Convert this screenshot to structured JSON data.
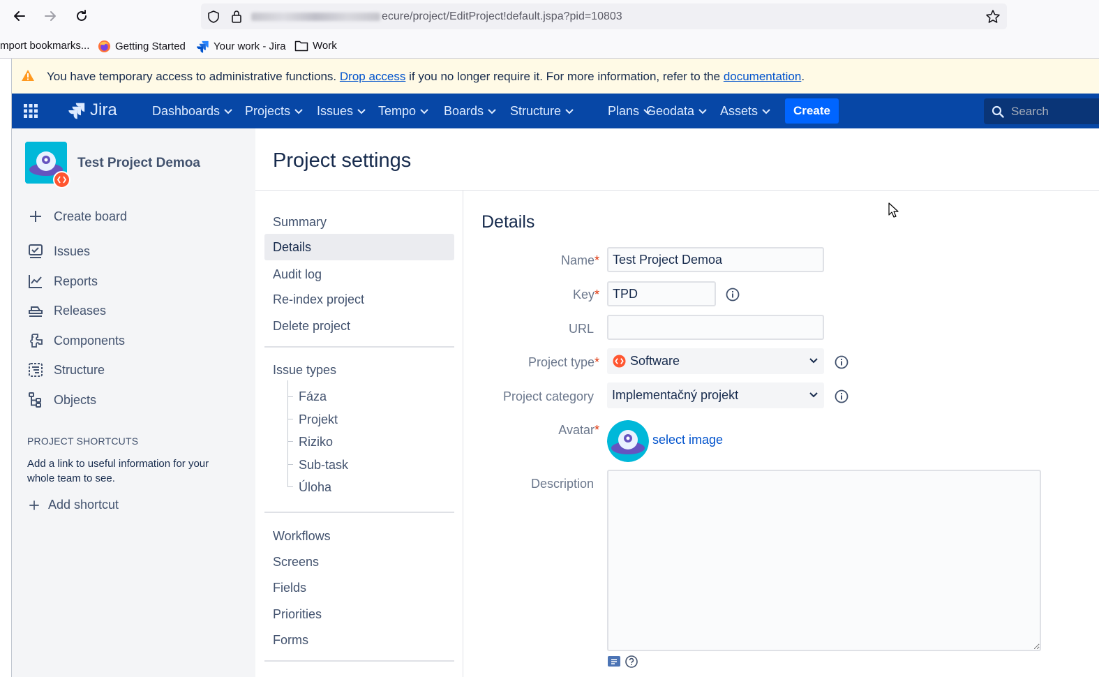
{
  "browser": {
    "url_suffix": "ecure/project/EditProject!default.jspa?pid=10803",
    "bookmarks": [
      "mport bookmarks...",
      "Getting Started",
      "Your work - Jira",
      "Work"
    ]
  },
  "banner": {
    "text_before": "You have temporary access to administrative functions.",
    "link1": "Drop access",
    "text_middle": "if you no longer require it. For more information, refer to the",
    "link2": "documentation",
    "text_after": "."
  },
  "topnav": {
    "logo": "Jira",
    "items": [
      "Dashboards",
      "Projects",
      "Issues",
      "Tempo",
      "Boards",
      "Structure",
      "Plans",
      "Geodata",
      "Assets"
    ],
    "create": "Create",
    "search_placeholder": "Search"
  },
  "sidebar": {
    "project_name": "Test Project Demoa",
    "create_board": "Create board",
    "items": [
      {
        "label": "Issues",
        "icon": "issues-icon"
      },
      {
        "label": "Reports",
        "icon": "reports-icon"
      },
      {
        "label": "Releases",
        "icon": "releases-icon"
      },
      {
        "label": "Components",
        "icon": "components-icon"
      },
      {
        "label": "Structure",
        "icon": "structure-icon"
      },
      {
        "label": "Objects",
        "icon": "objects-icon"
      }
    ],
    "shortcuts_title": "PROJECT SHORTCUTS",
    "shortcuts_desc_line1": "Add a link to useful information for your",
    "shortcuts_desc_line2": "whole team to see.",
    "add_shortcut": "Add shortcut"
  },
  "page_title": "Project settings",
  "settings_nav": {
    "group1": [
      "Summary",
      "Details",
      "Audit log",
      "Re-index project",
      "Delete project"
    ],
    "selected": "Details",
    "issue_types_title": "Issue types",
    "issue_types": [
      "Fáza",
      "Projekt",
      "Riziko",
      "Sub-task",
      "Úloha"
    ],
    "group3": [
      "Workflows",
      "Screens",
      "Fields",
      "Priorities",
      "Forms"
    ]
  },
  "details": {
    "title": "Details",
    "name_label": "Name",
    "name_value": "Test Project Demoa",
    "key_label": "Key",
    "key_value": "TPD",
    "url_label": "URL",
    "url_value": "",
    "type_label": "Project type",
    "type_value": "Software",
    "category_label": "Project category",
    "category_value": "Implementačný projekt",
    "avatar_label": "Avatar",
    "avatar_link": "select image",
    "description_label": "Description",
    "description_value": "",
    "required_mark": "*"
  }
}
